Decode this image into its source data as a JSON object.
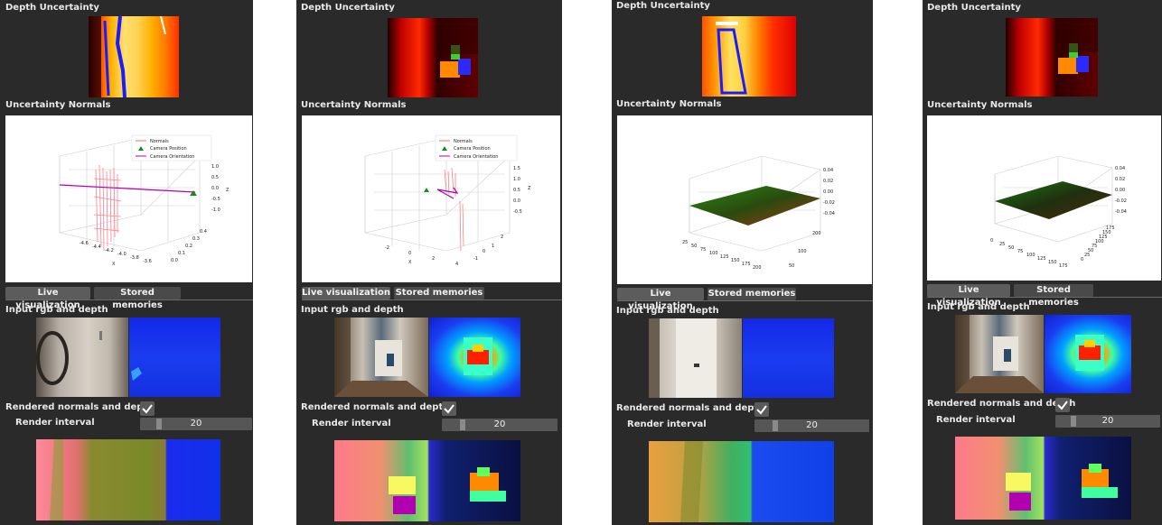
{
  "panels": [
    {
      "depth_uncertainty_label": "Depth Uncertainty",
      "uncertainty_normals_label": "Uncertainty Normals",
      "legend": [
        "Normals",
        "Camera Position",
        "Camera Orientation"
      ],
      "z_ticks": [
        "1.0",
        "0.5",
        "0.0",
        "-0.5",
        "-1.0"
      ],
      "z_axis_letter": "Z",
      "x_ticks": [
        "-4.6",
        "-4.4",
        "-4.2",
        "-4.0",
        "-3.8",
        "-3.6"
      ],
      "x_axis_letter": "X",
      "y_ticks": [
        "0.4",
        "0.3",
        "0.2",
        "0.1",
        "0.0"
      ],
      "tabs": [
        "Live visualization",
        "Stored memories"
      ],
      "input_label": "Input rgb and depth",
      "rendered_label": "Rendered normals and depth",
      "render_interval_label": "Render interval",
      "render_interval_value": "20"
    },
    {
      "depth_uncertainty_label": "Depth Uncertainty",
      "uncertainty_normals_label": "Uncertainty Normals",
      "legend": [
        "Normals",
        "Camera Position",
        "Camera Orientation"
      ],
      "z_ticks": [
        "1.5",
        "1.0",
        "0.5",
        "0.0",
        "-0.5"
      ],
      "z_axis_letter": "Z",
      "x_ticks": [
        "-2",
        "0",
        "2",
        "4"
      ],
      "x_axis_letter": "X",
      "y_ticks": [
        "2",
        "1",
        "0",
        "-1"
      ],
      "tabs": [
        "Live visualization",
        "Stored memories"
      ],
      "input_label": "Input rgb and depth",
      "rendered_label": "Rendered normals and depth",
      "render_interval_label": "Render interval",
      "render_interval_value": "20"
    },
    {
      "depth_uncertainty_label": "Depth Uncertainty",
      "uncertainty_normals_label": "Uncertainty Normals",
      "z_ticks": [
        "0.04",
        "0.02",
        "0.00",
        "-0.02",
        "-0.04"
      ],
      "x_ticks": [
        "25",
        "50",
        "75",
        "100",
        "125",
        "150",
        "175",
        "200"
      ],
      "y_ticks": [
        "200",
        "100",
        "50"
      ],
      "tabs": [
        "Live visualization",
        "Stored memories"
      ],
      "input_label": "Input rgb and depth",
      "rendered_label": "Rendered normals and depth",
      "render_interval_label": "Render interval",
      "render_interval_value": "20"
    },
    {
      "depth_uncertainty_label": "Depth Uncertainty",
      "uncertainty_normals_label": "Uncertainty Normals",
      "z_ticks": [
        "0.04",
        "0.02",
        "0.00",
        "-0.02",
        "-0.04"
      ],
      "x_ticks": [
        "0",
        "25",
        "50",
        "75",
        "100",
        "125",
        "150",
        "175"
      ],
      "y_ticks": [
        "175",
        "150",
        "125",
        "100",
        "75",
        "50",
        "25",
        "0"
      ],
      "tabs": [
        "Live visualization",
        "Stored memories"
      ],
      "input_label": "Input rgb and depth",
      "rendered_label": "Rendered normals and depth",
      "render_interval_label": "Render interval",
      "render_interval_value": "20"
    }
  ]
}
